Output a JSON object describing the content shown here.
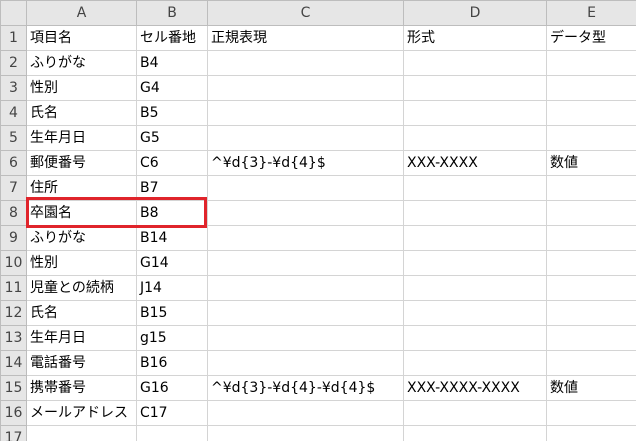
{
  "columns": [
    "A",
    "B",
    "C",
    "D",
    "E"
  ],
  "rows": [
    {
      "num": "1",
      "cells": [
        "項目名",
        "セル番地",
        "正規表現",
        "形式",
        "データ型"
      ]
    },
    {
      "num": "2",
      "cells": [
        "ふりがな",
        "B4",
        "",
        "",
        ""
      ]
    },
    {
      "num": "3",
      "cells": [
        "性別",
        "G4",
        "",
        "",
        ""
      ]
    },
    {
      "num": "4",
      "cells": [
        "氏名",
        "B5",
        "",
        "",
        ""
      ]
    },
    {
      "num": "5",
      "cells": [
        "生年月日",
        "G5",
        "",
        "",
        ""
      ]
    },
    {
      "num": "6",
      "cells": [
        "郵便番号",
        "C6",
        "^¥d{3}-¥d{4}$",
        "XXX-XXXX",
        "数値"
      ]
    },
    {
      "num": "7",
      "cells": [
        "住所",
        "B7",
        "",
        "",
        ""
      ]
    },
    {
      "num": "8",
      "cells": [
        "卒園名",
        "B8",
        "",
        "",
        ""
      ]
    },
    {
      "num": "9",
      "cells": [
        "ふりがな",
        "B14",
        "",
        "",
        ""
      ]
    },
    {
      "num": "10",
      "cells": [
        "性別",
        "G14",
        "",
        "",
        ""
      ]
    },
    {
      "num": "11",
      "cells": [
        "児童との続柄",
        "J14",
        "",
        "",
        ""
      ]
    },
    {
      "num": "12",
      "cells": [
        "氏名",
        "B15",
        "",
        "",
        ""
      ]
    },
    {
      "num": "13",
      "cells": [
        "生年月日",
        "g15",
        "",
        "",
        ""
      ]
    },
    {
      "num": "14",
      "cells": [
        "電話番号",
        "B16",
        "",
        "",
        ""
      ]
    },
    {
      "num": "15",
      "cells": [
        "携帯番号",
        "G16",
        "^¥d{3}-¥d{4}-¥d{4}$",
        "XXX-XXXX-XXXX",
        "数値"
      ]
    },
    {
      "num": "16",
      "cells": [
        "メールアドレス",
        "C17",
        "",
        "",
        ""
      ]
    },
    {
      "num": "17",
      "cells": [
        "",
        "",
        "",
        "",
        ""
      ]
    }
  ],
  "highlight_color": "#e0242b"
}
